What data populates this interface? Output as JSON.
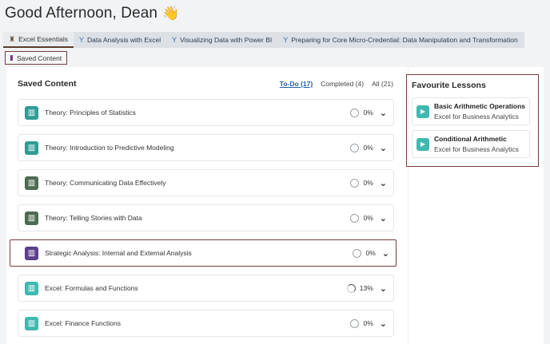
{
  "header": {
    "greeting": "Good Afternoon, Dean",
    "wave": "👋"
  },
  "tabs": [
    {
      "label": "Excel Essentials",
      "icon": "badge-icon",
      "glyph": "♜",
      "active": true
    },
    {
      "label": "Data Analysis with Excel",
      "icon": "trophy-icon",
      "glyph": "Y"
    },
    {
      "label": "Visualizing Data with Power BI",
      "icon": "trophy-icon",
      "glyph": "Y"
    },
    {
      "label": "Preparing for Core Micro-Credential: Data Manipulation and Transformation",
      "icon": "trophy-icon",
      "glyph": "Y"
    }
  ],
  "saved_button": {
    "label": "Saved Content",
    "glyph": "▮"
  },
  "saved_content": {
    "title": "Saved Content",
    "filters": {
      "todo": "To-Do (17)",
      "completed": "Completed (4)",
      "all": "All (21)"
    },
    "items": [
      {
        "title": "Theory: Principles of Statistics",
        "progress": "0%",
        "color": "#2f9c95",
        "glyph": "▥"
      },
      {
        "title": "Theory: Introduction to Predictive Modeling",
        "progress": "0%",
        "color": "#2f9c95",
        "glyph": "▥"
      },
      {
        "title": "Theory: Communicating Data Effectively",
        "progress": "0%",
        "color": "#4d6b52",
        "glyph": "▥"
      },
      {
        "title": "Theory: Telling Stories with Data",
        "progress": "0%",
        "color": "#4d6b52",
        "glyph": "▥"
      },
      {
        "title": "Strategic Analysis: Internal and External Analysis",
        "progress": "0%",
        "color": "#5b3f8c",
        "glyph": "▥"
      },
      {
        "title": "Excel: Formulas and Functions",
        "progress": "13%",
        "color": "#3fb8b0",
        "glyph": "▥"
      },
      {
        "title": "Excel: Finance Functions",
        "progress": "0%",
        "color": "#3fb8b0",
        "glyph": "▥"
      }
    ]
  },
  "favourites": {
    "title": "Favourite Lessons",
    "lessons": [
      {
        "name": "Basic Arithmetic Operations",
        "course": "Excel for Business Analytics"
      },
      {
        "name": "Conditional Arithmetic",
        "course": "Excel for Business Analytics"
      }
    ]
  },
  "icons": {
    "play": "▶",
    "chevron": "⌄"
  }
}
